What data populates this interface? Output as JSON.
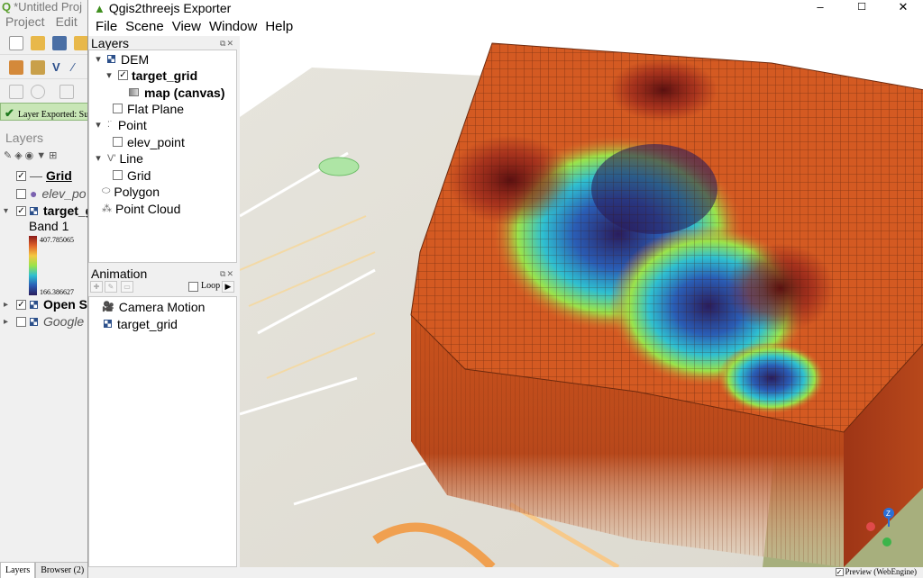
{
  "bg_app": {
    "title": "*Untitled Proj",
    "menu": [
      "Project",
      "Edit"
    ],
    "message": "Layer Exported: Suc",
    "layers_title": "Layers",
    "layers": [
      {
        "label": "Grid",
        "checked": true
      },
      {
        "label": "elev_po",
        "checked": false
      },
      {
        "label": "target_g",
        "checked": true
      },
      {
        "label": "Open St",
        "checked": true
      },
      {
        "label": "Google",
        "checked": false
      }
    ],
    "band_label": "Band 1",
    "legend_max": "407.785065",
    "legend_min": "166.386627",
    "tabs": [
      "Layers",
      "Browser (2)"
    ]
  },
  "exporter": {
    "title": "Qgis2threejs Exporter",
    "window_controls": {
      "minimize": "–",
      "maximize": "☐",
      "close": "✕"
    },
    "menu": [
      "File",
      "Scene",
      "View",
      "Window",
      "Help"
    ],
    "layers_panel": {
      "title": "Layers",
      "items": [
        {
          "label": "DEM",
          "icon": "dem-icon"
        },
        {
          "label": "target_grid",
          "icon": "dem-icon",
          "checked": true
        },
        {
          "label": "map (canvas)",
          "icon": "image-icon"
        },
        {
          "label": "Flat Plane",
          "checked": false
        },
        {
          "label": "Point",
          "icon": "point-icon"
        },
        {
          "label": "elev_point",
          "checked": false
        },
        {
          "label": "Line",
          "icon": "line-icon"
        },
        {
          "label": "Grid",
          "checked": false
        },
        {
          "label": "Polygon",
          "icon": "polygon-icon"
        },
        {
          "label": "Point Cloud",
          "icon": "pointcloud-icon"
        }
      ]
    },
    "animation_panel": {
      "title": "Animation",
      "loop_label": "Loop",
      "items": [
        {
          "label": "Camera Motion",
          "icon": "camera-icon"
        },
        {
          "label": "target_grid",
          "icon": "dem-icon"
        }
      ]
    },
    "status": {
      "preview_label": "Preview (WebEngine)",
      "preview_checked": true
    },
    "colors": {
      "terrain_high": "#b8481b",
      "terrain_low": "#2a1d5c",
      "accent": "#3f8f1f"
    }
  }
}
